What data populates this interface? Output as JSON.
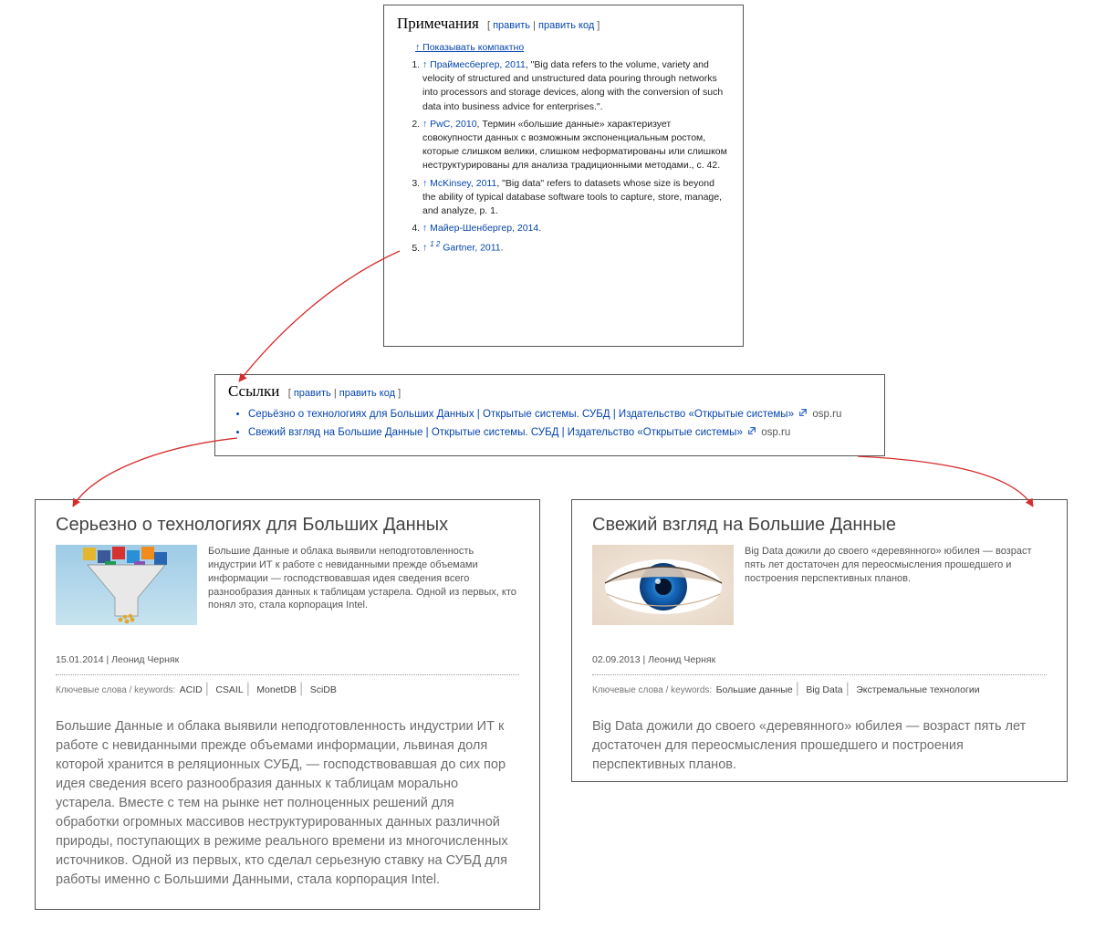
{
  "references": {
    "heading": "Примечания",
    "edit_label": "править",
    "edit_code_label": "править код",
    "toggle_compact": "Показывать компактно",
    "items": [
      {
        "source_link": "Праймесбергер, 2011",
        "text": ", \"Big data refers to the volume, variety and velocity of structured and unstructured data pouring through networks into processors and storage devices, along with the conversion of such data into business advice for enterprises.\"."
      },
      {
        "source_link": "PwC, 2010",
        "text": ", Термин «большие данные» характеризует совокупности данных с возможным экспоненциальным ростом, которые слишком велики, слишком неформатированы или слишком неструктурированы для анализа традиционными методами., с. 42."
      },
      {
        "source_link": "McKinsey, 2011",
        "text": ", \"Big data\" refers to datasets whose size is beyond the ability of typical database software tools to capture, store, manage, and analyze, p. 1."
      },
      {
        "source_link": "Майер-Шенбергер, 2014",
        "text": "."
      },
      {
        "source_link": "Gartner, 2011",
        "text": ".",
        "sup": "1 2"
      }
    ]
  },
  "links": {
    "heading": "Ссылки",
    "edit_label": "править",
    "edit_code_label": "править код",
    "items": [
      {
        "text": "Серьёзно о технологиях для Больших Данных | Открытые системы. СУБД | Издательство «Открытые системы»",
        "domain": "osp.ru"
      },
      {
        "text": "Свежий взгляд на Большие Данные | Открытые системы. СУБД | Издательство «Открытые системы»",
        "domain": "osp.ru"
      }
    ]
  },
  "article1": {
    "title": "Серьезно о технологиях для Больших Данных",
    "lead": "Большие Данные и облака выявили неподготовленность индустрии ИТ к работе с невиданными прежде объемами информации — господствовавшая идея сведения всего разнообразия данных к таблицам устарела. Одной из первых, кто понял это, стала корпорация Intel.",
    "date": "15.01.2014",
    "author": "Леонид Черняк",
    "kw_label": "Ключевые слова / keywords:",
    "keywords": [
      "ACID",
      "CSAIL",
      "MonetDB",
      "SciDB"
    ],
    "body": "Большие Данные и облака выявили неподготовленность индустрии ИТ к работе с невиданными прежде объемами информации, львиная доля которой хранится в реляционных СУБД, — господствовавшая до сих пор идея сведения всего разнообразия данных к таблицам морально устарела. Вместе с тем на рынке нет полноценных решений для обработки огромных массивов неструктурированных данных различной природы, поступающих в режиме реального времени из многочисленных источников. Одной из первых, кто сделал серьезную ставку на СУБД для работы именно с Большими Данными, стала корпорация Intel."
  },
  "article2": {
    "title": "Свежий взгляд на Большие Данные",
    "lead": "Big Data дожили до своего «деревянного» юбилея — возраст пять лет достаточен для переосмысления прошедшего и построения перспективных планов.",
    "date": "02.09.2013",
    "author": "Леонид Черняк",
    "kw_label": "Ключевые слова / keywords:",
    "keywords": [
      "Большие данные",
      "Big Data",
      "Экстремальные технологии"
    ],
    "body": "Big Data дожили до своего «деревянного» юбилея — возраст пять лет достаточен для переосмысления прошедшего и построения перспективных планов."
  }
}
